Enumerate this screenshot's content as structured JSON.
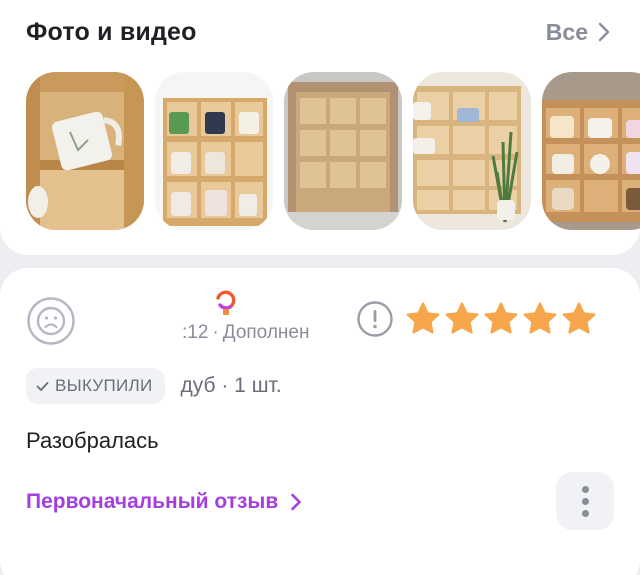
{
  "photos": {
    "title": "Фото и видео",
    "see_all_label": "Все",
    "thumbnails": [
      {
        "icon": "photo-mug-on-shelf"
      },
      {
        "icon": "photo-shelf-with-mugs"
      },
      {
        "icon": "photo-empty-shelf"
      },
      {
        "icon": "photo-shelf-with-plant"
      },
      {
        "icon": "photo-shelf-with-cups"
      }
    ]
  },
  "review": {
    "author_name": "",
    "date": ":12",
    "date_separator": "·",
    "status": "Дополнен",
    "rating": 5,
    "star_color": "#f7a64b",
    "bought_label": "ВЫКУПИЛИ",
    "variant": "дуб · 1 шт.",
    "text": "Разобралась",
    "original_link_label": "Первоначальный отзыв",
    "link_color": "#a53ee0"
  }
}
